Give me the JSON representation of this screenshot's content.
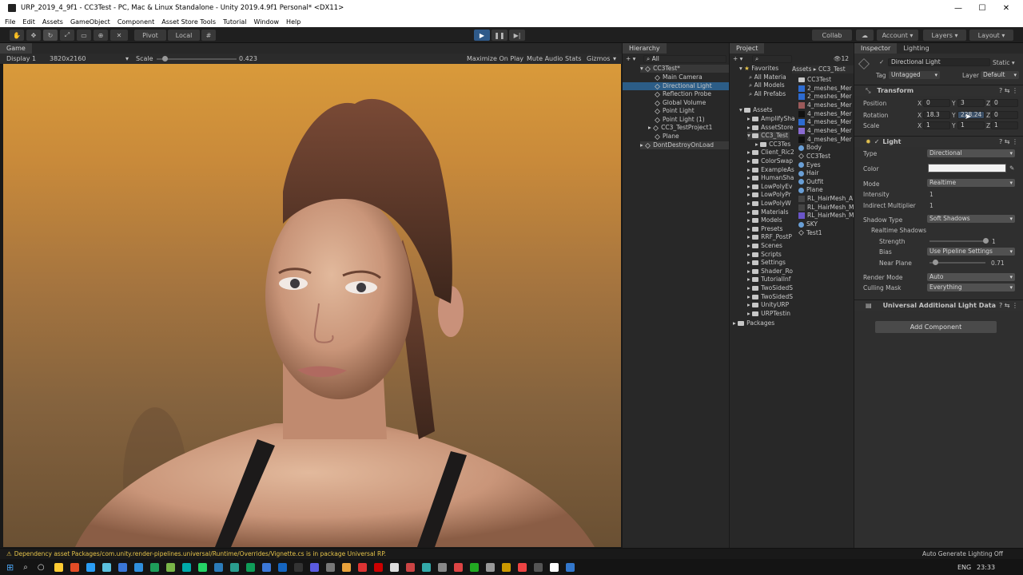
{
  "window": {
    "title": "URP_2019_4_9f1 - CC3Test - PC, Mac & Linux Standalone - Unity 2019.4.9f1 Personal* <DX11>",
    "min": "—",
    "max": "☐",
    "close": "✕"
  },
  "menu": [
    "File",
    "Edit",
    "Assets",
    "GameObject",
    "Component",
    "Asset Store Tools",
    "Tutorial",
    "Window",
    "Help"
  ],
  "toolbar": {
    "pivot": "Pivot",
    "local": "Local",
    "collab": "Collab",
    "account": "Account",
    "layers": "Layers",
    "layout": "Layout"
  },
  "game": {
    "tab": "Game",
    "display": "Display 1",
    "resolution": "3820x2160",
    "scale_label": "Scale",
    "scale_value": "0.423",
    "scale_fraction": 0.1,
    "maximize": "Maximize On Play",
    "mute": "Mute Audio",
    "stats": "Stats",
    "gizmos": "Gizmos"
  },
  "hierarchy": {
    "tab": "Hierarchy",
    "search": "All",
    "scene": "CC3Test*",
    "items": [
      "Main Camera",
      "Directional Light",
      "Reflection Probe",
      "Global Volume",
      "Point Light",
      "Point Light (1)",
      "CC3_TestProject1",
      "Plane"
    ],
    "dontdestroy": "DontDestroyOnLoad"
  },
  "project": {
    "tab": "Project",
    "favorites_label": "Favorites",
    "favorites": [
      "All Materia",
      "All Models",
      "All Prefabs"
    ],
    "assets_label": "Assets",
    "folders": [
      "CC3_Test",
      "CC3Tes",
      "Client_Ric2",
      "ColorSwap",
      "ExampleAs",
      "HumanSha",
      "LowPolyEv",
      "LowPolyPr",
      "LowPolyW",
      "Materials",
      "Models",
      "Presets",
      "RRF_PostP",
      "Scenes",
      "Scripts",
      "Settings",
      "Shader_Ro",
      "TutorialInf",
      "TwoSidedS",
      "TwoSidedS",
      "UnityURP",
      "URPTestin"
    ],
    "folders_first": [
      "AmplifySha",
      "AssetStore"
    ],
    "packages": "Packages",
    "count": "12",
    "breadcrumb": [
      "Assets",
      "CC3_Test"
    ],
    "assets": [
      "CC3Test",
      "2_meshes_Mer",
      "2_meshes_Mer",
      "4_meshes_Mer",
      "4_meshes_Mer",
      "4_meshes_Mer",
      "4_meshes_Mer",
      "4_meshes_Mer",
      "Body",
      "CC3Test",
      "Eyes",
      "Hair",
      "Outfit",
      "Plane",
      "RL_HairMesh_A",
      "RL_HairMesh_M",
      "RL_HairMesh_M",
      "SKY",
      "Test1"
    ]
  },
  "inspector": {
    "tab": "Inspector",
    "lighting_tab": "Lighting",
    "object_name": "Directional Light",
    "static": "Static",
    "tag_label": "Tag",
    "tag": "Untagged",
    "layer_label": "Layer",
    "layer": "Default",
    "transform": {
      "title": "Transform",
      "position_label": "Position",
      "rotation_label": "Rotation",
      "scale_label": "Scale",
      "position": [
        "0",
        "3",
        "0"
      ],
      "rotation": [
        "18.3",
        "228.24",
        "0"
      ],
      "scale": [
        "1",
        "1",
        "1"
      ]
    },
    "light": {
      "title": "Light",
      "type_label": "Type",
      "type": "Directional",
      "color_label": "Color",
      "color": "#f2f2f2",
      "mode_label": "Mode",
      "mode": "Realtime",
      "intensity_label": "Intensity",
      "intensity": "1",
      "indirect_label": "Indirect Multiplier",
      "indirect": "1",
      "shadow_type_label": "Shadow Type",
      "shadow_type": "Soft Shadows",
      "realtime_shadows": "Realtime Shadows",
      "strength_label": "Strength",
      "strength": "1",
      "strength_fraction": 1.0,
      "bias_label": "Bias",
      "bias": "Use Pipeline Settings",
      "near_label": "Near Plane",
      "near": "0.71",
      "near_fraction": 0.1,
      "render_mode_label": "Render Mode",
      "render_mode": "Auto",
      "culling_label": "Culling Mask",
      "culling": "Everything"
    },
    "urp": "Universal Additional Light Data",
    "add_component": "Add Component"
  },
  "status": {
    "message": "Dependency asset Packages/com.unity.render-pipelines.universal/Runtime/Overrides/Vignette.cs is in package Universal RP.",
    "right": "Auto Generate Lighting Off"
  },
  "taskbar": {
    "lang": "ENG",
    "time": "23:33"
  }
}
